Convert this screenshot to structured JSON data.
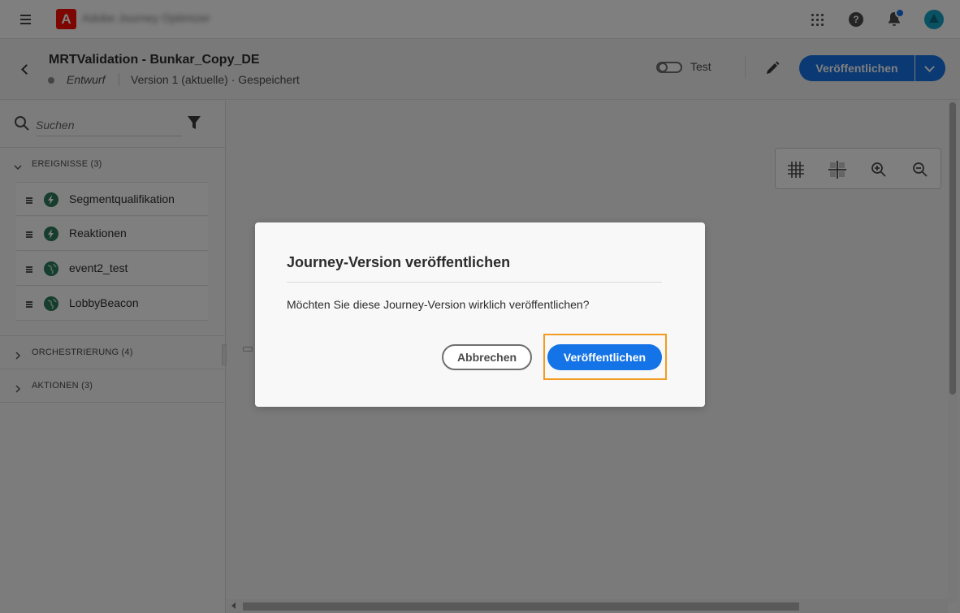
{
  "topbar": {
    "org_name": "Adobe Journey Optimizer",
    "icons": [
      "menu-icon",
      "adobe-logo",
      "apps-grid-icon",
      "help-icon",
      "notifications-bell-icon",
      "user-avatar"
    ],
    "accent_color": "#1473e6"
  },
  "journey": {
    "title": "MRTValidation - Bunkar_Copy_DE",
    "status": "Entwurf",
    "version": "Version 1 (aktuelle) · Gespeichert",
    "test_label": "Test",
    "test_enabled": false,
    "publish_label": "Veröffentlichen"
  },
  "sidebar": {
    "search_placeholder": "Suchen",
    "categories": [
      {
        "label": "EREIGNISSE (3)",
        "expanded": true
      },
      {
        "label": "ORCHESTRIERUNG (4)",
        "expanded": false
      },
      {
        "label": "AKTIONEN (3)",
        "expanded": false
      }
    ],
    "events": [
      {
        "label": "Segmentqualifikation",
        "icon": "lightning-icon"
      },
      {
        "label": "Reaktionen",
        "icon": "lightning-icon"
      },
      {
        "label": "event2_test",
        "icon": "globe-icon"
      },
      {
        "label": "LobbyBeacon",
        "icon": "globe-icon"
      }
    ]
  },
  "canvas_toolbar": {
    "icons": [
      "grid-icon",
      "auto-arrange-icon",
      "zoom-in-icon",
      "zoom-out-icon"
    ]
  },
  "dialog": {
    "title": "Journey-Version veröffentlichen",
    "message": "Möchten Sie diese Journey-Version wirklich veröffentlichen?",
    "cancel_label": "Abbrechen",
    "confirm_label": "Veröffentlichen",
    "highlight_color": "#f29b1f"
  }
}
